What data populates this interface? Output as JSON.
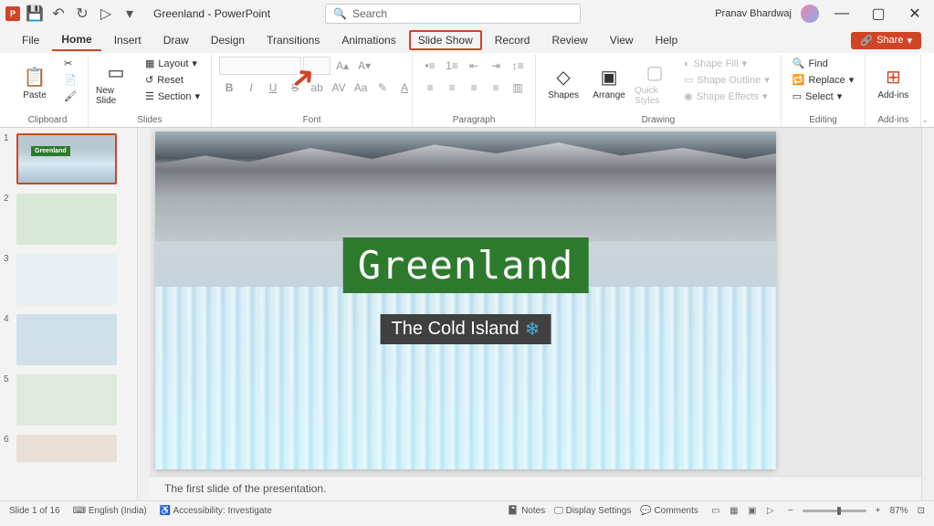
{
  "app": {
    "title": "Greenland - PowerPoint",
    "icon_letter": "P"
  },
  "qat": {
    "save": "💾",
    "undo": "↶",
    "redo": "↻",
    "start": "▷"
  },
  "search": {
    "placeholder": "Search"
  },
  "user": {
    "name": "Pranav Bhardwaj"
  },
  "tabs": [
    "File",
    "Home",
    "Insert",
    "Draw",
    "Design",
    "Transitions",
    "Animations",
    "Slide Show",
    "Record",
    "Review",
    "View",
    "Help"
  ],
  "share": "Share",
  "ribbon": {
    "clipboard": {
      "label": "Clipboard",
      "paste": "Paste"
    },
    "slides": {
      "label": "Slides",
      "new_slide": "New Slide",
      "layout": "Layout",
      "reset": "Reset",
      "section": "Section"
    },
    "font": {
      "label": "Font"
    },
    "paragraph": {
      "label": "Paragraph"
    },
    "drawing": {
      "label": "Drawing",
      "shapes": "Shapes",
      "arrange": "Arrange",
      "quick_styles": "Quick Styles",
      "fill": "Shape Fill",
      "outline": "Shape Outline",
      "effects": "Shape Effects"
    },
    "editing": {
      "label": "Editing",
      "find": "Find",
      "replace": "Replace",
      "select": "Select"
    },
    "addins": {
      "label": "Add-ins",
      "btn": "Add-ins"
    }
  },
  "thumbs": [
    "1",
    "2",
    "3",
    "4",
    "5",
    "6"
  ],
  "slide": {
    "title": "Greenland",
    "subtitle": "The Cold Island",
    "snowflake": "❄"
  },
  "notes": "The first slide of the presentation.",
  "status": {
    "slide": "Slide 1 of 16",
    "lang": "English (India)",
    "access": "Accessibility: Investigate",
    "notes_btn": "Notes",
    "display": "Display Settings",
    "comments": "Comments",
    "zoom": "87%"
  }
}
